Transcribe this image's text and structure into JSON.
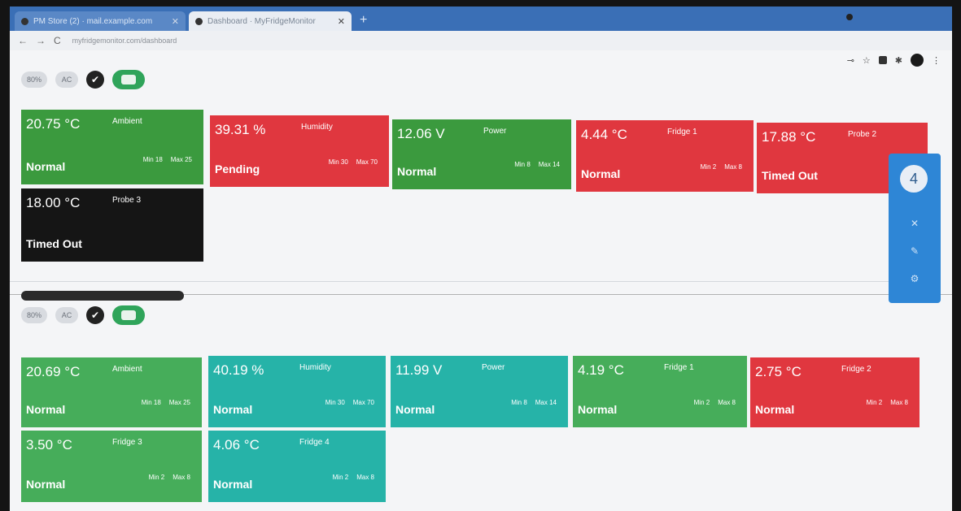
{
  "browser": {
    "tabs": [
      {
        "label": "PM Store (2) · mail.example.com"
      },
      {
        "label": "Dashboard · MyFridgeMonitor"
      }
    ],
    "new_tab": "+",
    "url": "myfridgemonitor.com/dashboard",
    "nav": {
      "back": "←",
      "forward": "→",
      "reload": "C"
    }
  },
  "sites": [
    {
      "name": "",
      "status": "",
      "chips": {
        "battery": "80%",
        "power": "AC",
        "check": "✔"
      },
      "cards": [
        {
          "reading": "20.75 °C",
          "name": "Ambient",
          "status": "Normal",
          "min": "Min 18",
          "max": "Max 25"
        },
        {
          "reading": "39.31 %",
          "name": "Humidity",
          "status": "Pending",
          "min": "Min 30",
          "max": "Max 70"
        },
        {
          "reading": "12.06 V",
          "name": "Power",
          "status": "Normal",
          "min": "Min 8",
          "max": "Max 14"
        },
        {
          "reading": "4.44 °C",
          "name": "Fridge 1",
          "status": "Normal",
          "min": "Min 2",
          "max": "Max 8"
        },
        {
          "reading": "17.88 °C",
          "name": "Probe 2",
          "status": "Timed Out",
          "min": "",
          "max": ""
        },
        {
          "reading": "18.00 °C",
          "name": "Probe 3",
          "status": "Timed Out",
          "min": "",
          "max": ""
        }
      ]
    },
    {
      "name": "",
      "status": "",
      "chips": {
        "battery": "80%",
        "power": "AC",
        "check": "✔"
      },
      "cards": [
        {
          "reading": "20.69 °C",
          "name": "Ambient",
          "status": "Normal",
          "min": "Min 18",
          "max": "Max 25"
        },
        {
          "reading": "40.19 %",
          "name": "Humidity",
          "status": "Normal",
          "min": "Min 30",
          "max": "Max 70"
        },
        {
          "reading": "11.99 V",
          "name": "Power",
          "status": "Normal",
          "min": "Min 8",
          "max": "Max 14"
        },
        {
          "reading": "4.19 °C",
          "name": "Fridge 1",
          "status": "Normal",
          "min": "Min 2",
          "max": "Max 8"
        },
        {
          "reading": "2.75 °C",
          "name": "Fridge 2",
          "status": "Normal",
          "min": "Min 2",
          "max": "Max 8"
        },
        {
          "reading": "3.50 °C",
          "name": "Fridge 3",
          "status": "Normal",
          "min": "Min 2",
          "max": "Max 8"
        },
        {
          "reading": "4.06 °C",
          "name": "Fridge 4",
          "status": "Normal",
          "min": "Min 2",
          "max": "Max 8"
        }
      ]
    }
  ],
  "side_panel": {
    "count": "4",
    "close": "✕",
    "edit": "✎",
    "settings": "⚙"
  }
}
